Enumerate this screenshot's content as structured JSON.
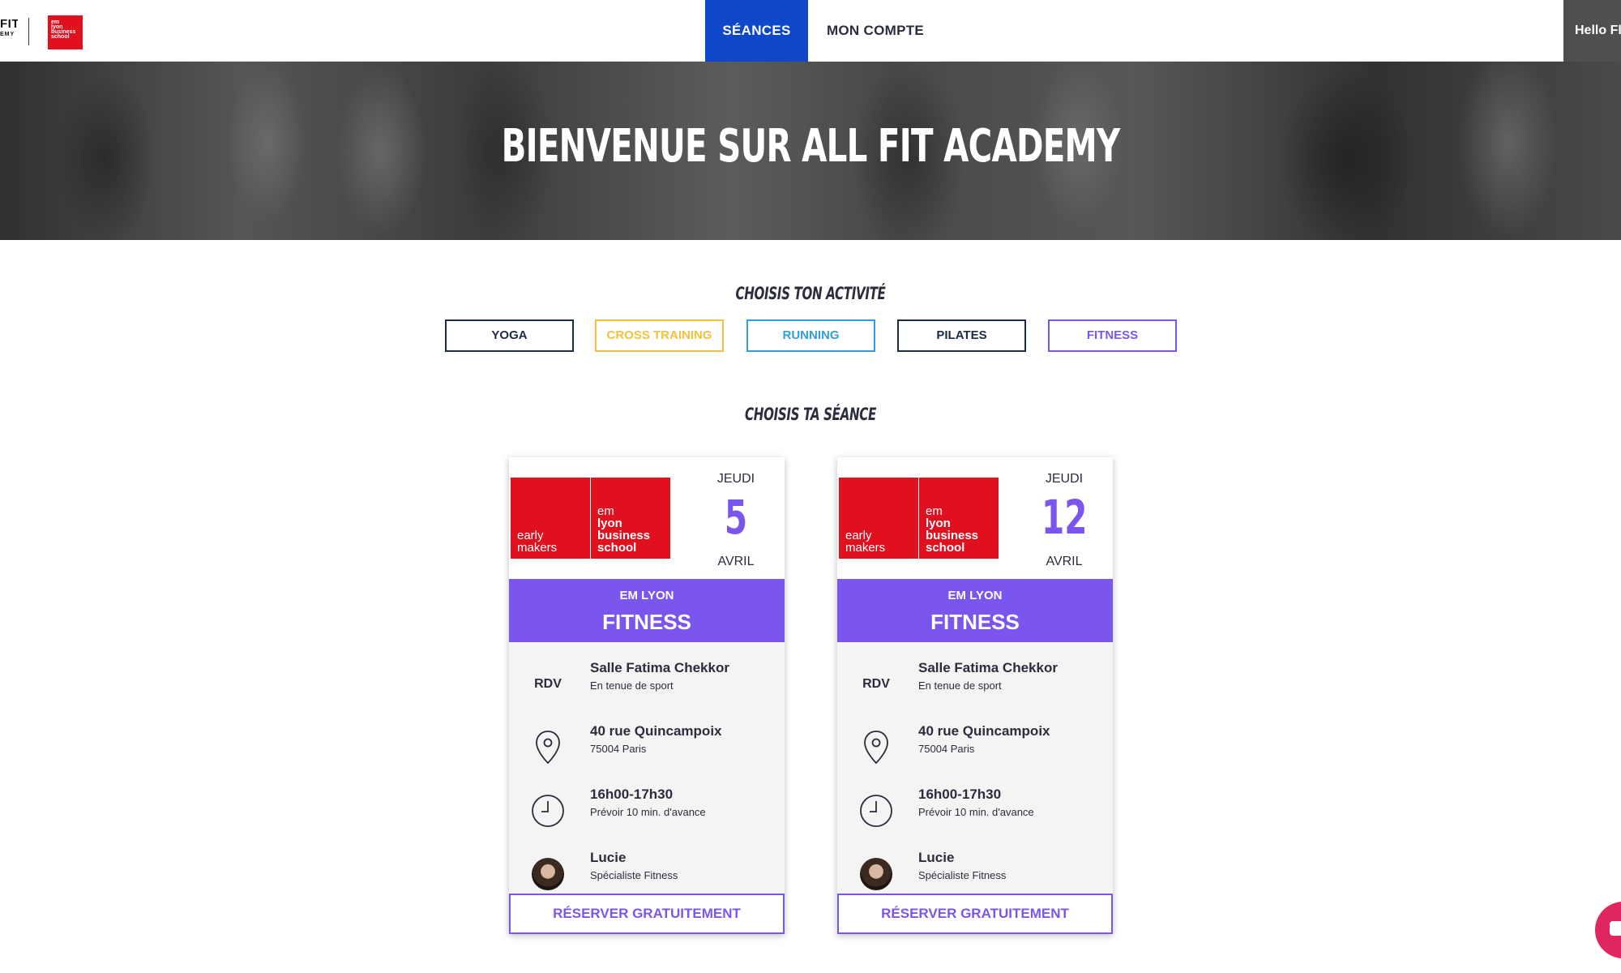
{
  "navbar": {
    "logo_allfit_line1": "FIT",
    "logo_allfit_line2": "EMY",
    "logo_emlyon_lines": [
      "em",
      "lyon",
      "business",
      "school"
    ],
    "tabs": [
      {
        "label": "SÉANCES",
        "active": true
      },
      {
        "label": "MON COMPTE",
        "active": false
      }
    ],
    "greeting": "Hello Fl",
    "active_color": "#0f47c9"
  },
  "hero": {
    "title": "Bienvenue sur All Fit Academy"
  },
  "activities": {
    "title": "Choisis ton activité",
    "items": [
      {
        "label": "YOGA",
        "color": "#1d2a44"
      },
      {
        "label": "CROSS TRAINING",
        "color": "#f3c23c"
      },
      {
        "label": "RUNNING",
        "color": "#2e9fe0"
      },
      {
        "label": "PILATES",
        "color": "#1d2a44"
      },
      {
        "label": "FITNESS",
        "color": "#7b56ee"
      }
    ]
  },
  "sessions": {
    "title": "Choisis ta séance",
    "cards": [
      {
        "logo_left": [
          "early",
          "makers"
        ],
        "logo_right": [
          "em",
          "lyon",
          "business",
          "school"
        ],
        "day": "JEUDI",
        "date": "5",
        "month": "AVRIL",
        "org": "EM LYON",
        "activity": "FITNESS",
        "rdv_label": "RDV",
        "place": "Salle Fatima Chekkor",
        "place_note": "En tenue de sport",
        "address": "40 rue Quincampoix",
        "city": "75004 Paris",
        "time": "16h00-17h30",
        "time_note": "Prévoir 10 min. d'avance",
        "coach": "Lucie",
        "coach_role": "Spécialiste Fitness",
        "cta": "RÉSERVER GRATUITEMENT"
      },
      {
        "logo_left": [
          "early",
          "makers"
        ],
        "logo_right": [
          "em",
          "lyon",
          "business",
          "school"
        ],
        "day": "JEUDI",
        "date": "12",
        "month": "AVRIL",
        "org": "EM LYON",
        "activity": "FITNESS",
        "rdv_label": "RDV",
        "place": "Salle Fatima Chekkor",
        "place_note": "En tenue de sport",
        "address": "40 rue Quincampoix",
        "city": "75004 Paris",
        "time": "16h00-17h30",
        "time_note": "Prévoir 10 min. d'avance",
        "coach": "Lucie",
        "coach_role": "Spécialiste Fitness",
        "cta": "RÉSERVER GRATUITEMENT"
      }
    ]
  },
  "colors": {
    "accent": "#7b56ee",
    "brand_red": "#e0101f",
    "chat": "#e0265e"
  },
  "chat_icon": "chat-icon"
}
